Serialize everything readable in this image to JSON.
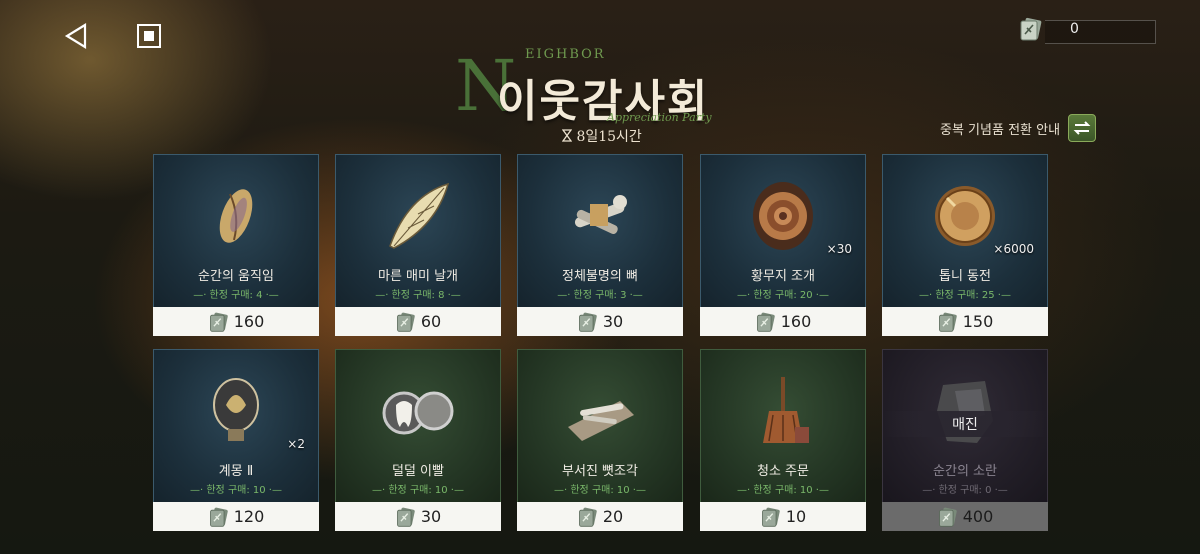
{
  "nav": {
    "back_icon": "back-triangle-icon",
    "home_icon": "stop-square-icon"
  },
  "currency": {
    "icon": "ticket-icon",
    "value": "0"
  },
  "event": {
    "title": "이웃감사회",
    "title_en": "EIGHBOR",
    "title_letter": "N",
    "subtitle": "Appreciation Party",
    "timer": "8일15시간",
    "timer_icon": "hourglass-icon"
  },
  "dup_guide": {
    "label": "중복 기념품 전환 안내",
    "icon": "swap-arrows-icon"
  },
  "price_icon": "ticket-icon",
  "items": [
    {
      "name": "순간의 움직임",
      "limit": "한정 구매: 4",
      "price": "160",
      "qty": "",
      "icon": "feather-leaf-icon",
      "style": "blue",
      "sold_out": false
    },
    {
      "name": "마른 매미 날개",
      "limit": "한정 구매: 8",
      "price": "60",
      "qty": "",
      "icon": "cicada-wing-icon",
      "style": "blue",
      "sold_out": false
    },
    {
      "name": "정체불명의 뼈",
      "limit": "한정 구매: 3",
      "price": "30",
      "qty": "",
      "icon": "bones-icon",
      "style": "blue",
      "sold_out": false
    },
    {
      "name": "황무지 조개",
      "limit": "한정 구매: 20",
      "price": "160",
      "qty": "×30",
      "icon": "ammonite-shell-icon",
      "style": "blue",
      "sold_out": false
    },
    {
      "name": "톱니 동전",
      "limit": "한정 구매: 25",
      "price": "150",
      "qty": "×6000",
      "icon": "gear-coin-icon",
      "style": "blue",
      "sold_out": false
    },
    {
      "name": "계몽 Ⅱ",
      "limit": "한정 구매: 10",
      "price": "120",
      "qty": "×2",
      "icon": "lightbulb-icon",
      "style": "blue",
      "sold_out": false
    },
    {
      "name": "덜덜 이빨",
      "limit": "한정 구매: 10",
      "price": "30",
      "qty": "",
      "icon": "tooth-locket-icon",
      "style": "green",
      "sold_out": false
    },
    {
      "name": "부서진 뼛조각",
      "limit": "한정 구매: 10",
      "price": "20",
      "qty": "",
      "icon": "bone-fragments-icon",
      "style": "green",
      "sold_out": false
    },
    {
      "name": "청소 주문",
      "limit": "한정 구매: 10",
      "price": "10",
      "qty": "",
      "icon": "broom-icon",
      "style": "green",
      "sold_out": false
    },
    {
      "name": "순간의 소란",
      "limit": "한정 구매: 0",
      "price": "400",
      "qty": "",
      "icon": "rock-icon",
      "style": "soldout",
      "sold_out": true,
      "sold_out_label": "매진"
    }
  ]
}
